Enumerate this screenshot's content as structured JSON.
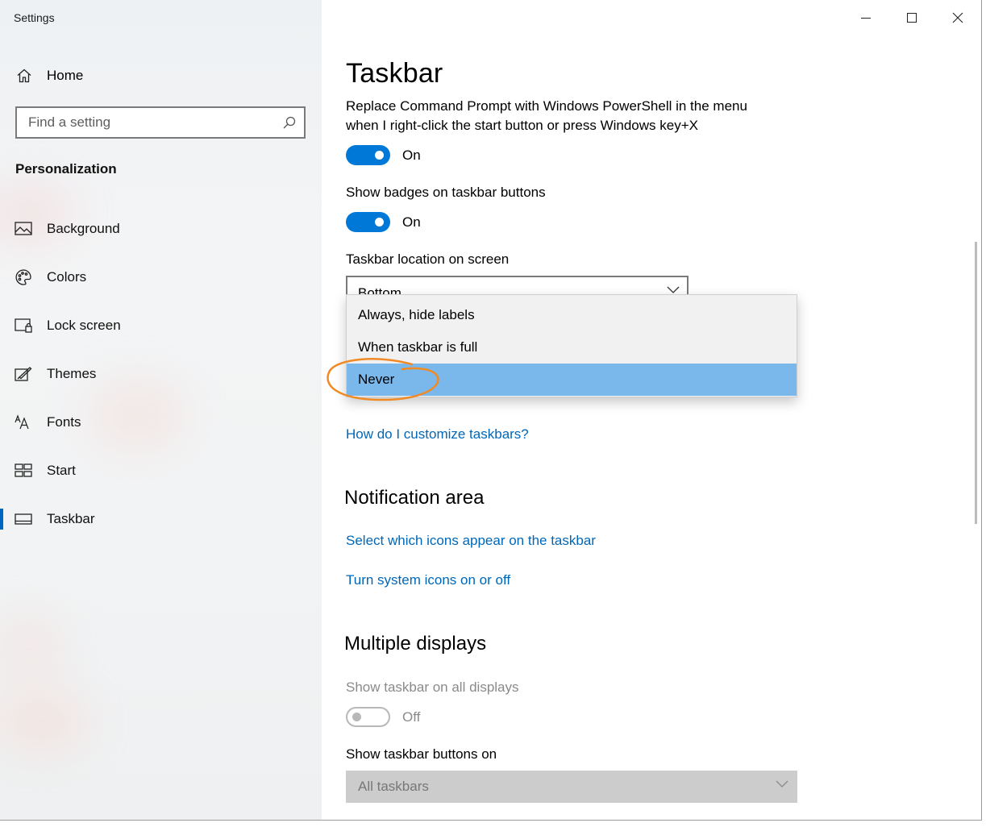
{
  "app": {
    "title": "Settings"
  },
  "sidebar": {
    "home_label": "Home",
    "search_placeholder": "Find a setting",
    "section_heading": "Personalization",
    "items": [
      {
        "label": "Background",
        "icon": "picture-icon"
      },
      {
        "label": "Colors",
        "icon": "palette-icon"
      },
      {
        "label": "Lock screen",
        "icon": "lock-screen-icon"
      },
      {
        "label": "Themes",
        "icon": "themes-icon"
      },
      {
        "label": "Fonts",
        "icon": "fonts-icon"
      },
      {
        "label": "Start",
        "icon": "start-icon"
      },
      {
        "label": "Taskbar",
        "icon": "taskbar-icon",
        "active": true
      }
    ]
  },
  "main": {
    "title": "Taskbar",
    "powershell": {
      "label_line1": "Replace Command Prompt with Windows PowerShell in the menu",
      "label_line2": "when I right-click the start button or press Windows key+X",
      "state": "On"
    },
    "badges": {
      "label": "Show badges on taskbar buttons",
      "state": "On"
    },
    "location": {
      "label": "Taskbar location on screen",
      "value": "Bottom"
    },
    "combine_popup": {
      "options": [
        "Always, hide labels",
        "When taskbar is full",
        "Never"
      ],
      "selected": "Never"
    },
    "help_link": "How do I customize taskbars?",
    "notification_area": {
      "title": "Notification area",
      "link1": "Select which icons appear on the taskbar",
      "link2": "Turn system icons on or off"
    },
    "multiple_displays": {
      "title": "Multiple displays",
      "show_all_label": "Show taskbar on all displays",
      "show_all_state": "Off",
      "buttons_on_label": "Show taskbar buttons on",
      "buttons_on_value": "All taskbars"
    }
  },
  "colors": {
    "accent": "#0078d7",
    "link": "#0067b8",
    "selection": "#7ab8ec",
    "annotation": "#f08a24"
  }
}
